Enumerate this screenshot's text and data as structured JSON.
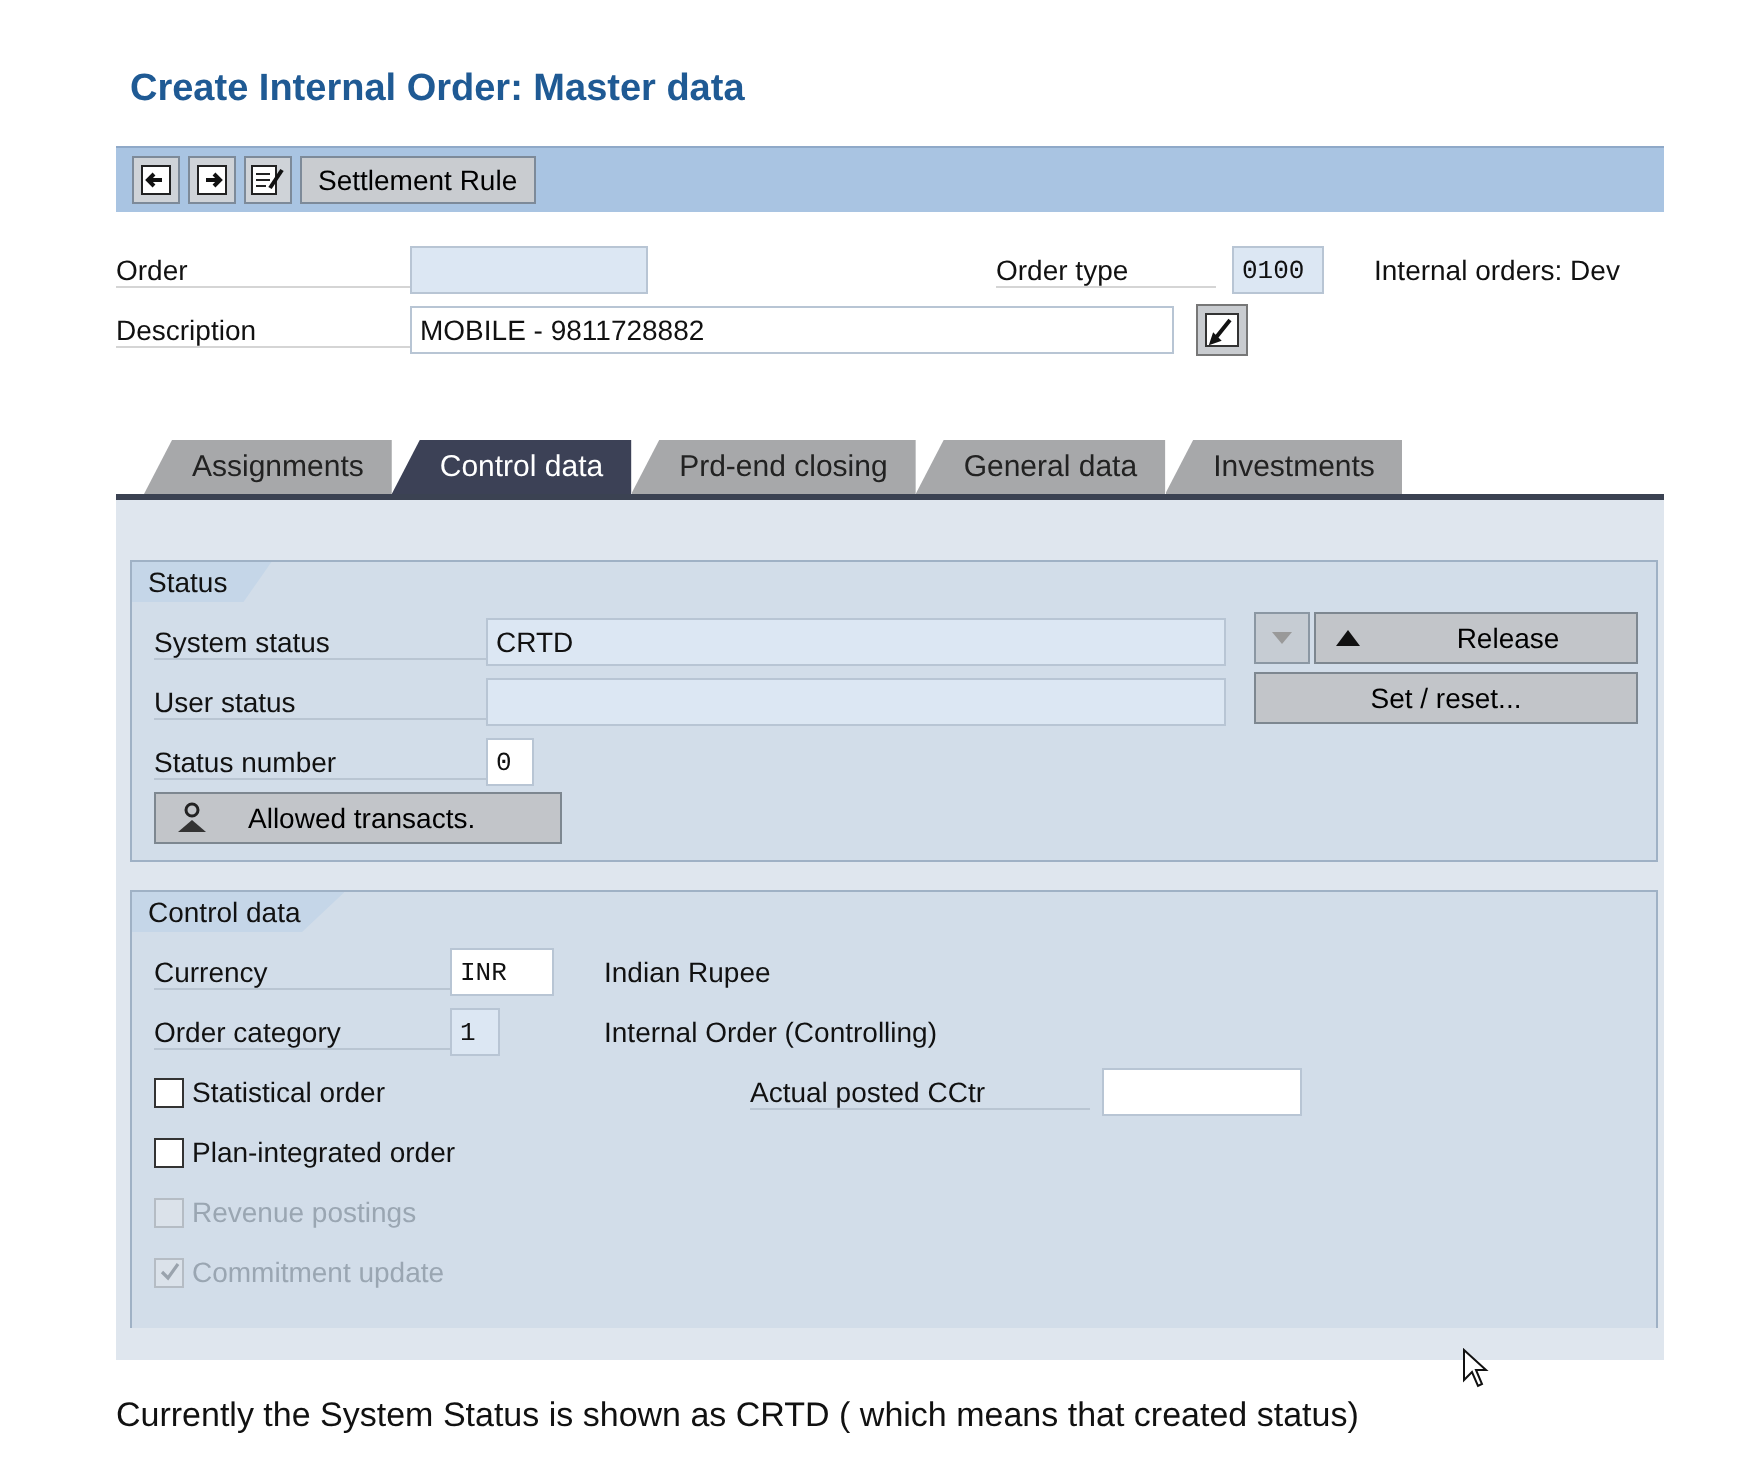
{
  "title": "Create Internal Order: Master data",
  "toolbar": {
    "settlement_button": "Settlement Rule"
  },
  "header": {
    "order": {
      "label": "Order"
    },
    "order_type": {
      "label": "Order type",
      "value": "0100",
      "text": "Internal orders: Dev"
    },
    "description": {
      "label": "Description",
      "value": "MOBILE - 9811728882"
    }
  },
  "tabs": [
    {
      "label": "Assignments",
      "selected": false
    },
    {
      "label": "Control data",
      "selected": true
    },
    {
      "label": "Prd-end closing",
      "selected": false
    },
    {
      "label": "General data",
      "selected": false
    },
    {
      "label": "Investments",
      "selected": false
    }
  ],
  "status": {
    "title": "Status",
    "system_status": {
      "label": "System status",
      "value": "CRTD"
    },
    "user_status": {
      "label": "User status"
    },
    "status_number": {
      "label": "Status number",
      "value": "0"
    },
    "allowed_button": "Allowed transacts.",
    "release_button": "Release",
    "set_reset_button": "Set / reset..."
  },
  "control": {
    "title": "Control data",
    "currency": {
      "label": "Currency",
      "value": "INR",
      "text": "Indian Rupee"
    },
    "order_category": {
      "label": "Order category",
      "value": "1",
      "text": "Internal Order (Controlling)"
    },
    "checkboxes": [
      {
        "label": "Statistical order",
        "checked": false,
        "disabled": false
      },
      {
        "label": "Plan-integrated order",
        "checked": false,
        "disabled": false
      },
      {
        "label": "Revenue postings",
        "checked": false,
        "disabled": true
      },
      {
        "label": "Commitment update",
        "checked": true,
        "disabled": true
      }
    ],
    "actual_posted": {
      "label": "Actual posted CCtr"
    }
  },
  "caption": "Currently the System Status is shown as CRTD ( which means that created status)"
}
